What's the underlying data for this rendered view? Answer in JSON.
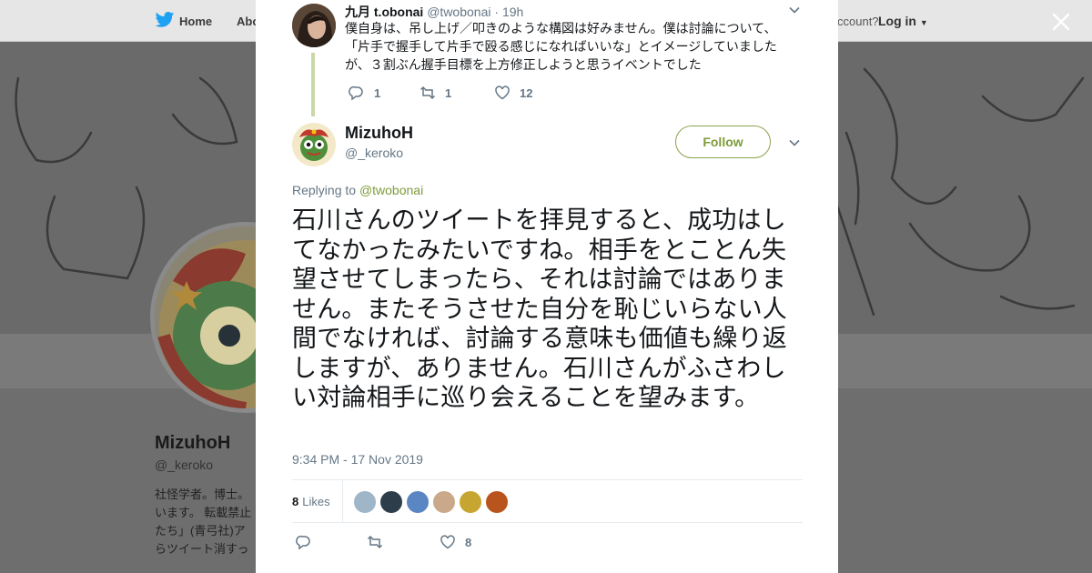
{
  "nav": {
    "home_label": "Home",
    "about_label": "Abo",
    "account_prompt": "ccount?",
    "login_label": "Log in"
  },
  "background_profile": {
    "name": "MizuhoH",
    "handle": "@_keroko",
    "bio_lines": [
      "社怪学者。博士。",
      "います。 転載禁止",
      "たち」(青弓社)ア",
      "らツイート消すっ"
    ]
  },
  "parent_tweet": {
    "author_name": "九月 t.obonai",
    "author_handle": "@twobonai",
    "separator": "·",
    "time": "19h",
    "text": "僕自身は、吊し上げ／叩きのような構図は好みません。僕は討論について、「片手で握手して片手で殴る感じになればいいな」とイメージしていましたが、３割ぶん握手目標を上方修正しようと思うイベントでした",
    "reply_count": "1",
    "retweet_count": "1",
    "like_count": "12"
  },
  "main_tweet": {
    "author_name": "MizuhoH",
    "author_handle": "@_keroko",
    "follow_label": "Follow",
    "replying_prefix": "Replying to",
    "replying_to": "@twobonai",
    "text": "石川さんのツイートを拝見すると、成功はしてなかったみたいですね。相手をとことん失望させてしまったら、それは討論ではありません。またそうさせた自分を恥じいらない人間でなければ、討論する意味も価値も繰り返しますが、ありません。石川さんがふさわしい対論相手に巡り会えることを望みます。",
    "timestamp": "9:34 PM - 17 Nov 2019",
    "likes_count": "8",
    "likes_label": "Likes",
    "action_like_count": "8",
    "likers": [
      {
        "name": "liker-1",
        "color": "#9fb6c8"
      },
      {
        "name": "liker-2",
        "color": "#2d3d4a"
      },
      {
        "name": "liker-3",
        "color": "#5b86c4"
      },
      {
        "name": "liker-4",
        "color": "#c9a98a"
      },
      {
        "name": "liker-5",
        "color": "#c7a531"
      },
      {
        "name": "liker-6",
        "color": "#b8541c"
      }
    ]
  },
  "colors": {
    "accent": "#7e9b3a",
    "muted_text": "#657786",
    "overlay": "#6b6b6b"
  }
}
